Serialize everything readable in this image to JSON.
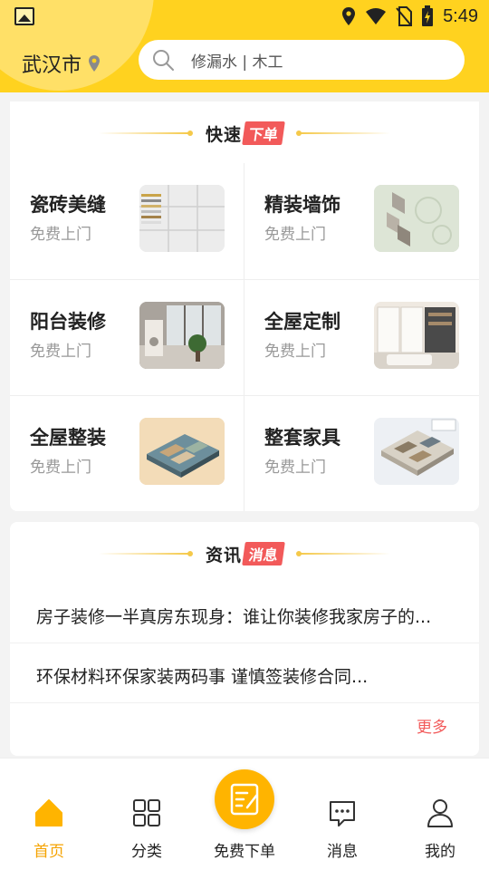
{
  "status_bar": {
    "time": "5:49"
  },
  "header": {
    "city": "武汉市",
    "search_placeholder": "修漏水 | 木工"
  },
  "quick_order": {
    "title": "快速",
    "tag": "下单",
    "items": [
      {
        "name": "瓷砖美缝",
        "sub": "免费上门"
      },
      {
        "name": "精装墙饰",
        "sub": "免费上门"
      },
      {
        "name": "阳台装修",
        "sub": "免费上门"
      },
      {
        "name": "全屋定制",
        "sub": "免费上门"
      },
      {
        "name": "全屋整装",
        "sub": "免费上门"
      },
      {
        "name": "整套家具",
        "sub": "免费上门"
      }
    ]
  },
  "news": {
    "title": "资讯",
    "tag": "消息",
    "items": [
      "房子装修一半真房东现身：谁让你装修我家房子的...",
      "环保材料环保家装两码事 谨慎签装修合同..."
    ],
    "more": "更多"
  },
  "bottom_nav": {
    "items": [
      "首页",
      "分类",
      "免费下单",
      "消息",
      "我的"
    ],
    "active_color": "#f5a300"
  },
  "colors": {
    "brand_yellow": "#ffd21f",
    "accent_red": "#f25a5a",
    "fab_orange": "#ffb400"
  }
}
